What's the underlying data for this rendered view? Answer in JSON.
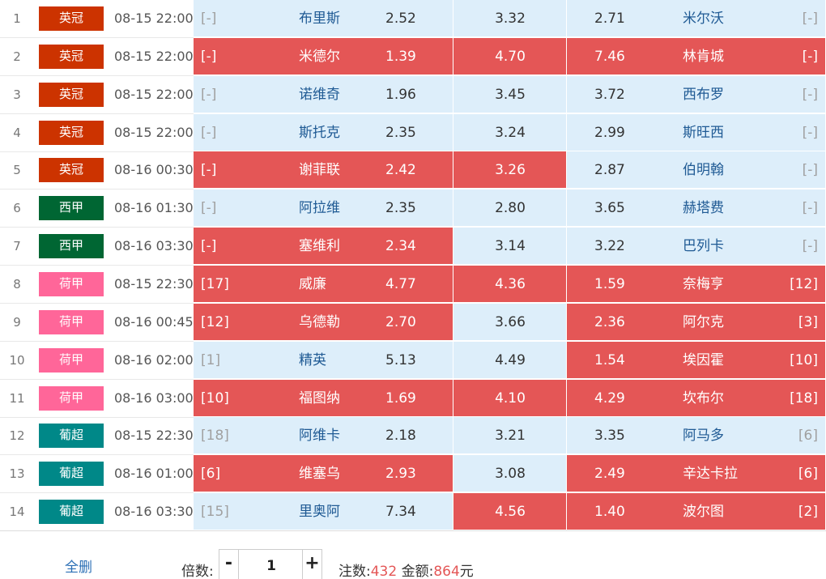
{
  "colors": {
    "league": {
      "英冠": "#cc3300",
      "西甲": "#006633",
      "荷甲": "#ff6699",
      "葡超": "#008888"
    },
    "cell_light": "#ddeefa",
    "cell_selected": "#e45656"
  },
  "rows": [
    {
      "idx": "1",
      "league": "英冠",
      "time": "08-15 22:00",
      "home_rank": "[-]",
      "home": "布里斯",
      "home_odds": "2.52",
      "draw_odds": "3.32",
      "away_odds": "2.71",
      "away": "米尔沃",
      "away_rank": "[-]",
      "sel": [
        false,
        false,
        false
      ]
    },
    {
      "idx": "2",
      "league": "英冠",
      "time": "08-15 22:00",
      "home_rank": "[-]",
      "home": "米德尔",
      "home_odds": "1.39",
      "draw_odds": "4.70",
      "away_odds": "7.46",
      "away": "林肯城",
      "away_rank": "[-]",
      "sel": [
        true,
        true,
        true
      ]
    },
    {
      "idx": "3",
      "league": "英冠",
      "time": "08-15 22:00",
      "home_rank": "[-]",
      "home": "诺维奇",
      "home_odds": "1.96",
      "draw_odds": "3.45",
      "away_odds": "3.72",
      "away": "西布罗",
      "away_rank": "[-]",
      "sel": [
        false,
        false,
        false
      ]
    },
    {
      "idx": "4",
      "league": "英冠",
      "time": "08-15 22:00",
      "home_rank": "[-]",
      "home": "斯托克",
      "home_odds": "2.35",
      "draw_odds": "3.24",
      "away_odds": "2.99",
      "away": "斯旺西",
      "away_rank": "[-]",
      "sel": [
        false,
        false,
        false
      ]
    },
    {
      "idx": "5",
      "league": "英冠",
      "time": "08-16 00:30",
      "home_rank": "[-]",
      "home": "谢菲联",
      "home_odds": "2.42",
      "draw_odds": "3.26",
      "away_odds": "2.87",
      "away": "伯明翰",
      "away_rank": "[-]",
      "sel": [
        true,
        true,
        false
      ]
    },
    {
      "idx": "6",
      "league": "西甲",
      "time": "08-16 01:30",
      "home_rank": "[-]",
      "home": "阿拉维",
      "home_odds": "2.35",
      "draw_odds": "2.80",
      "away_odds": "3.65",
      "away": "赫塔费",
      "away_rank": "[-]",
      "sel": [
        false,
        false,
        false
      ]
    },
    {
      "idx": "7",
      "league": "西甲",
      "time": "08-16 03:30",
      "home_rank": "[-]",
      "home": "塞维利",
      "home_odds": "2.34",
      "draw_odds": "3.14",
      "away_odds": "3.22",
      "away": "巴列卡",
      "away_rank": "[-]",
      "sel": [
        true,
        false,
        false
      ]
    },
    {
      "idx": "8",
      "league": "荷甲",
      "time": "08-15 22:30",
      "home_rank": "[17]",
      "home": "威廉",
      "home_odds": "4.77",
      "draw_odds": "4.36",
      "away_odds": "1.59",
      "away": "奈梅亨",
      "away_rank": "[12]",
      "sel": [
        true,
        true,
        true
      ]
    },
    {
      "idx": "9",
      "league": "荷甲",
      "time": "08-16 00:45",
      "home_rank": "[12]",
      "home": "乌德勒",
      "home_odds": "2.70",
      "draw_odds": "3.66",
      "away_odds": "2.36",
      "away": "阿尔克",
      "away_rank": "[3]",
      "sel": [
        true,
        false,
        true
      ]
    },
    {
      "idx": "10",
      "league": "荷甲",
      "time": "08-16 02:00",
      "home_rank": "[1]",
      "home": "精英",
      "home_odds": "5.13",
      "draw_odds": "4.49",
      "away_odds": "1.54",
      "away": "埃因霍",
      "away_rank": "[10]",
      "sel": [
        false,
        false,
        true
      ]
    },
    {
      "idx": "11",
      "league": "荷甲",
      "time": "08-16 03:00",
      "home_rank": "[10]",
      "home": "福图纳",
      "home_odds": "1.69",
      "draw_odds": "4.10",
      "away_odds": "4.29",
      "away": "坎布尔",
      "away_rank": "[18]",
      "sel": [
        true,
        true,
        true
      ]
    },
    {
      "idx": "12",
      "league": "葡超",
      "time": "08-15 22:30",
      "home_rank": "[18]",
      "home": "阿维卡",
      "home_odds": "2.18",
      "draw_odds": "3.21",
      "away_odds": "3.35",
      "away": "阿马多",
      "away_rank": "[6]",
      "sel": [
        false,
        false,
        false
      ]
    },
    {
      "idx": "13",
      "league": "葡超",
      "time": "08-16 01:00",
      "home_rank": "[6]",
      "home": "维塞乌",
      "home_odds": "2.93",
      "draw_odds": "3.08",
      "away_odds": "2.49",
      "away": "辛达卡拉",
      "away_rank": "[6]",
      "sel": [
        true,
        false,
        true
      ]
    },
    {
      "idx": "14",
      "league": "葡超",
      "time": "08-16 03:30",
      "home_rank": "[15]",
      "home": "里奥阿",
      "home_odds": "7.34",
      "draw_odds": "4.56",
      "away_odds": "1.40",
      "away": "波尔图",
      "away_rank": "[2]",
      "sel": [
        false,
        true,
        true
      ]
    }
  ],
  "footer": {
    "clear_all": "全删",
    "multiplier_label": "倍数:",
    "minus": "-",
    "plus": "+",
    "multiplier_value": "1",
    "bets_label": "注数:",
    "bets_value": "432",
    "amount_label": "金额:",
    "amount_value": "864",
    "amount_unit": "元"
  }
}
